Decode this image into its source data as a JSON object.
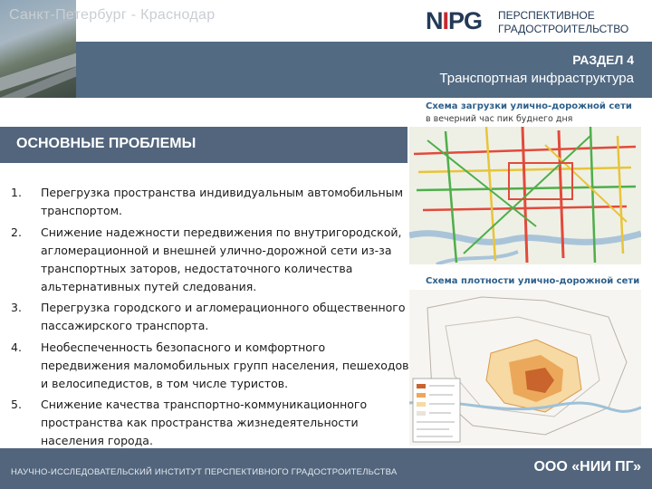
{
  "header": {
    "city": "Санкт-Петербург - Краснодар",
    "logo_mark": "NIIPG",
    "logo_line1": "ПЕРСПЕКТИВНОЕ",
    "logo_line2": "ГРАДОСТРОИТЕЛЬСТВО"
  },
  "section": {
    "label": "РАЗДЕЛ 4",
    "title": "Транспортная инфраструктура"
  },
  "problems": {
    "title": "ОСНОВНЫЕ ПРОБЛЕМЫ",
    "items": [
      {
        "num": "1.",
        "text": "Перегрузка пространства индивидуальным автомобильным транспортом."
      },
      {
        "num": "2.",
        "text": "Снижение надежности передвижения по внутригородской, агломерационной и внешней улично-дорожной сети из-за транспортных заторов, недостаточного количества альтернативных путей следования."
      },
      {
        "num": "3.",
        "text": "Перегрузка городского и агломерационного общественного пассажирского транспорта."
      },
      {
        "num": "4.",
        "text": "Необеспеченность безопасного и комфортного передвижения маломобильных групп населения, пешеходов и велосипедистов, в том числе туристов."
      },
      {
        "num": "5.",
        "text": "Снижение качества транспортно-коммуникационного пространства как пространства жизнедеятельности населения города."
      }
    ]
  },
  "maps": {
    "map1_title": "Схема загрузки улично-дорожной сети",
    "map1_subtitle": "в вечерний час пик буднего дня",
    "map2_title": "Схема плотности улично-дорожной сети"
  },
  "footer": {
    "institute": "НАУЧНО-ИССЛЕДОВАТЕЛЬСКИЙ ИНСТИТУТ ПЕРСПЕКТИВНОГО ГРАДОСТРОИТЕЛЬСТВА",
    "company": "ООО «НИИ ПГ»"
  },
  "colors": {
    "band": "#526a82",
    "accent_red": "#c8282e",
    "logo_blue": "#233a57"
  }
}
